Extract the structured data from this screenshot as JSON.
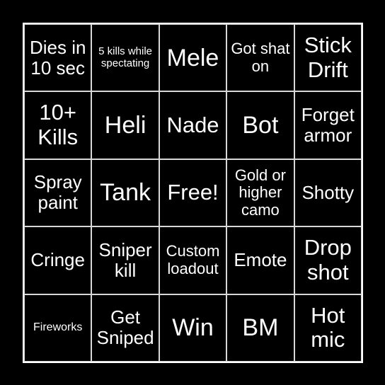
{
  "board": {
    "cells": [
      {
        "label": "Dies in 10 sec",
        "size": "s3"
      },
      {
        "label": "5 kills while spectating",
        "size": "s6"
      },
      {
        "label": "Mele",
        "size": "s1"
      },
      {
        "label": "Got shat on",
        "size": "s4"
      },
      {
        "label": "Stick Drift",
        "size": "s2"
      },
      {
        "label": "10+ Kills",
        "size": "s2"
      },
      {
        "label": "Heli",
        "size": "s1"
      },
      {
        "label": "Nade",
        "size": "s2"
      },
      {
        "label": "Bot",
        "size": "s1"
      },
      {
        "label": "Forget armor",
        "size": "s3"
      },
      {
        "label": "Spray paint",
        "size": "s3"
      },
      {
        "label": "Tank",
        "size": "s1"
      },
      {
        "label": "Free!",
        "size": "s2"
      },
      {
        "label": "Gold or higher camo",
        "size": "s4"
      },
      {
        "label": "Shotty",
        "size": "s3"
      },
      {
        "label": "Cringe",
        "size": "s3"
      },
      {
        "label": "Sniper kill",
        "size": "s3"
      },
      {
        "label": "Custom loadout",
        "size": "s4"
      },
      {
        "label": "Emote",
        "size": "s3"
      },
      {
        "label": "Drop shot",
        "size": "s2"
      },
      {
        "label": "Fireworks",
        "size": "s5"
      },
      {
        "label": "Get Sniped",
        "size": "s3"
      },
      {
        "label": "Win",
        "size": "s1"
      },
      {
        "label": "BM",
        "size": "s1"
      },
      {
        "label": "Hot mic",
        "size": "s2"
      }
    ]
  }
}
